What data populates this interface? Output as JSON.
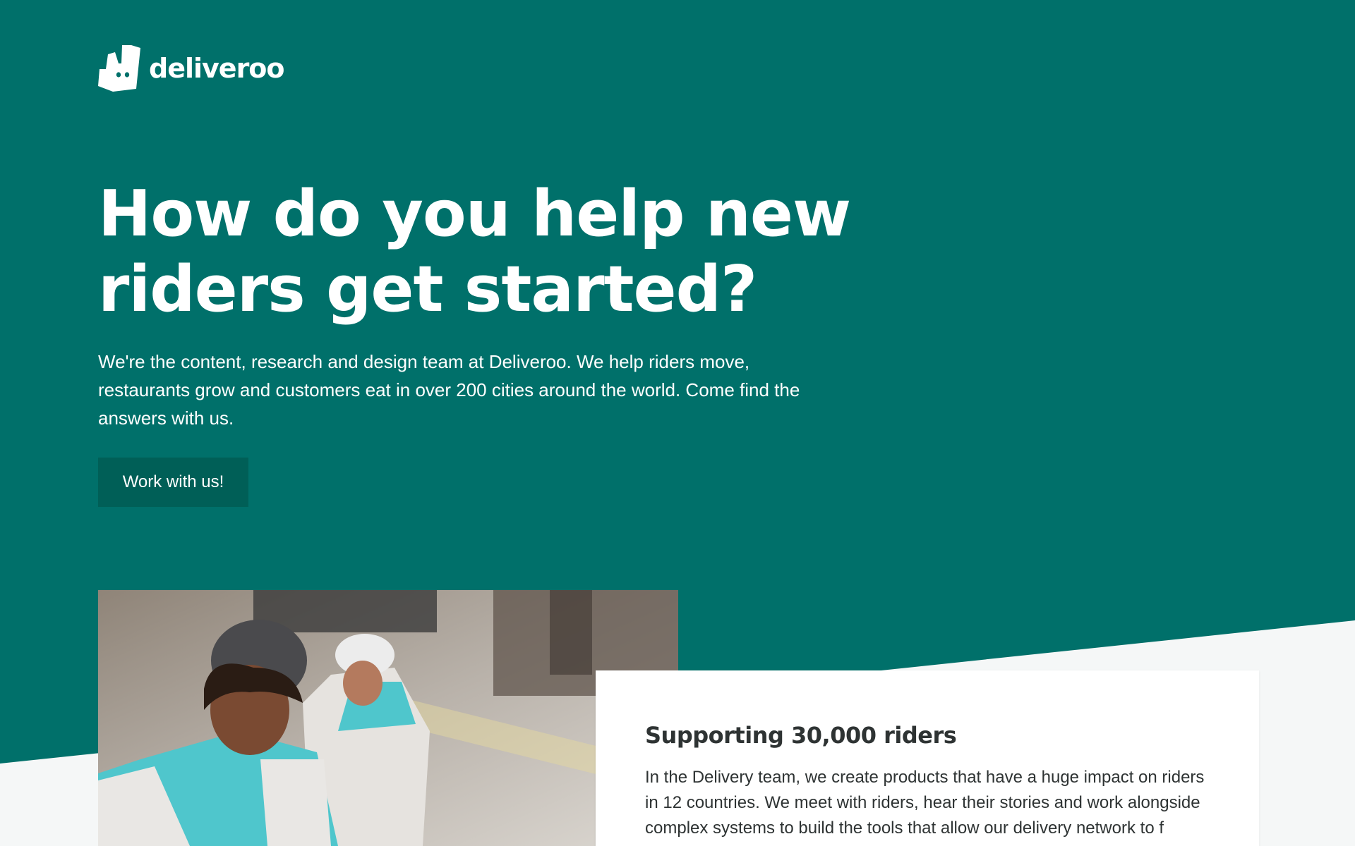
{
  "brand": {
    "name": "deliveroo",
    "logo_icon": "deliveroo-kangaroo-icon",
    "primary_color": "#00706a",
    "button_color": "#005f57",
    "background_light": "#f5f7f7"
  },
  "hero": {
    "headline": "How do you help new riders get started?",
    "intro": "We're the content, research and design team at Deliveroo. We help riders move, restaurants grow and customers eat in over 200 cities around the world. Come find the answers with us.",
    "cta_label": "Work with us!"
  },
  "feature": {
    "title": "Supporting 30,000 riders",
    "body": "In the Delivery team, we create products that have a huge impact on riders in 12 countries. We meet with riders, hear their stories and work alongside complex systems to build the tools that allow our delivery network to f"
  }
}
